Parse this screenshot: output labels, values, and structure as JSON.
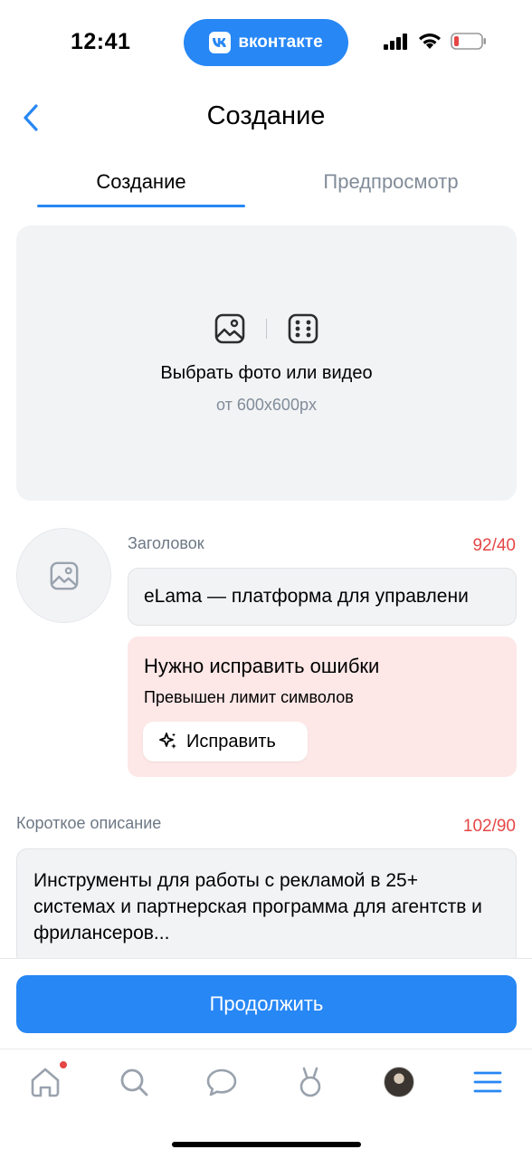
{
  "status_bar": {
    "time": "12:41",
    "app_pill_label": "вконтакте",
    "app_logo_text": "vk",
    "battery_color": "#E64646"
  },
  "header": {
    "title": "Создание",
    "back_icon": "chevron-left-icon"
  },
  "tabs": [
    {
      "label": "Создание",
      "active": true
    },
    {
      "label": "Предпросмотр",
      "active": false
    }
  ],
  "upload": {
    "label": "Выбрать фото или видео",
    "sublabel": "от 600x600px",
    "icons": [
      "image-icon",
      "dice-icon"
    ]
  },
  "headline": {
    "label": "Заголовок",
    "counter": "92/40",
    "value": "eLama — платформа для управлени"
  },
  "error": {
    "title": "Нужно исправить ошибки",
    "text": "Превышен лимит символов",
    "fix_label": "Исправить"
  },
  "description": {
    "label": "Короткое описание",
    "counter": "102/90",
    "value": "Инструменты для работы с рекламой в 25+ системах и партнерская программа для агентств и фрилансеров..."
  },
  "continue_label": "Продолжить",
  "tabbar": {
    "items": [
      "home-icon",
      "search-icon",
      "messages-icon",
      "clips-icon",
      "avatar",
      "menu-icon"
    ],
    "home_has_notification": true
  },
  "colors": {
    "accent": "#2787F5",
    "error": "#E64646",
    "error_bg": "#FDE7E7",
    "field_bg": "#F2F3F5"
  }
}
